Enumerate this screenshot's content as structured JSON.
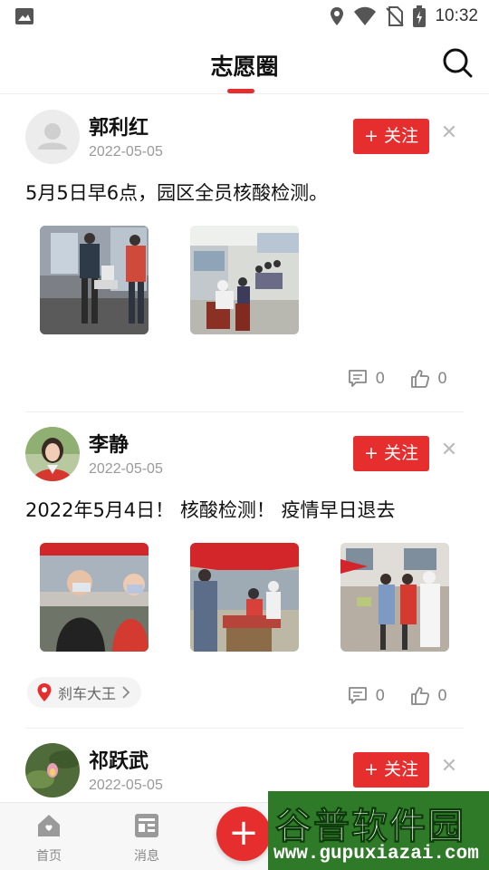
{
  "status_bar": {
    "time": "10:32"
  },
  "header": {
    "title": "志愿圈"
  },
  "posts": [
    {
      "user": "郭利红",
      "date": "2022-05-05",
      "follow_label": "+ 关注",
      "text": "5月5日早6点，园区全员核酸检测。",
      "comments": "0",
      "likes": "0"
    },
    {
      "user": "李静",
      "date": "2022-05-05",
      "follow_label": "+ 关注",
      "text": "2022年5月4日！ 核酸检测！ 疫情早日退去",
      "location": "刹车大王",
      "comments": "0",
      "likes": "0"
    },
    {
      "user": "祁跃武",
      "date": "2022-05-05",
      "follow_label": "+ 关注"
    }
  ],
  "bottom_nav": {
    "home": "首页",
    "messages": "消息"
  },
  "watermark": {
    "name": "谷普软件园",
    "url": "www.gupuxiazai.com"
  },
  "colors": {
    "accent": "#e62e2e"
  },
  "icons": [
    "image-icon",
    "location-icon",
    "wifi-icon",
    "no-sim-icon",
    "battery-icon",
    "search-icon",
    "close-icon",
    "comment-icon",
    "like-icon",
    "pin-icon",
    "chevron-right-icon",
    "home-icon",
    "messages-icon",
    "add-icon"
  ]
}
